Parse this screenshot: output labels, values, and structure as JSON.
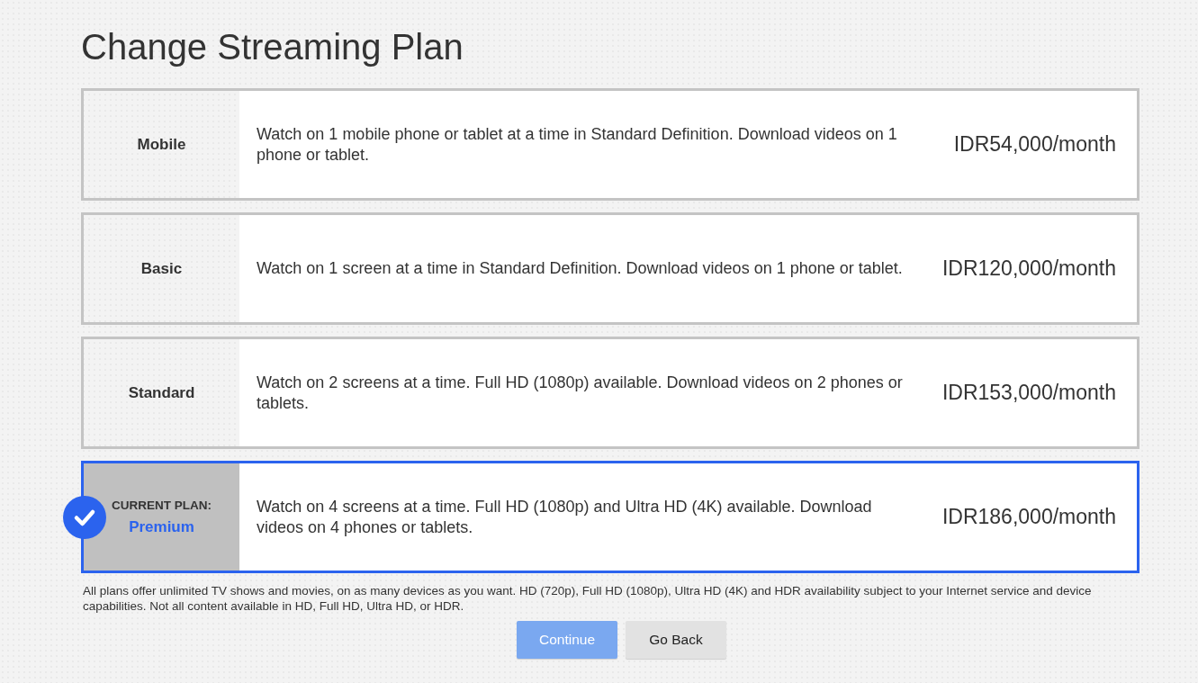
{
  "title": "Change Streaming Plan",
  "plans": [
    {
      "name": "Mobile",
      "description": "Watch on 1 mobile phone or tablet at a time in Standard Definition. Download videos on 1 phone or tablet.",
      "price": "IDR54,000/month",
      "selected": false
    },
    {
      "name": "Basic",
      "description": "Watch on 1 screen at a time in Standard Definition. Download videos on 1 phone or tablet.",
      "price": "IDR120,000/month",
      "selected": false
    },
    {
      "name": "Standard",
      "description": "Watch on 2 screens at a time. Full HD (1080p) available. Download videos on 2 phones or tablets.",
      "price": "IDR153,000/month",
      "selected": false
    },
    {
      "name": "Premium",
      "current_label": "CURRENT PLAN:",
      "description": "Watch on 4 screens at a time. Full HD (1080p) and Ultra HD (4K) available. Download videos on 4 phones or tablets.",
      "price": "IDR186,000/month",
      "selected": true
    }
  ],
  "footnote": "All plans offer unlimited TV shows and movies, on as many devices as you want. HD (720p), Full HD (1080p), Ultra HD (4K) and HDR availability subject to your Internet service and device capabilities. Not all content available in HD, Full HD, Ultra HD, or HDR.",
  "buttons": [
    {
      "label": "Continue",
      "kind": "primary",
      "disabled": true
    },
    {
      "label": "Go Back",
      "kind": "secondary",
      "disabled": false
    }
  ]
}
